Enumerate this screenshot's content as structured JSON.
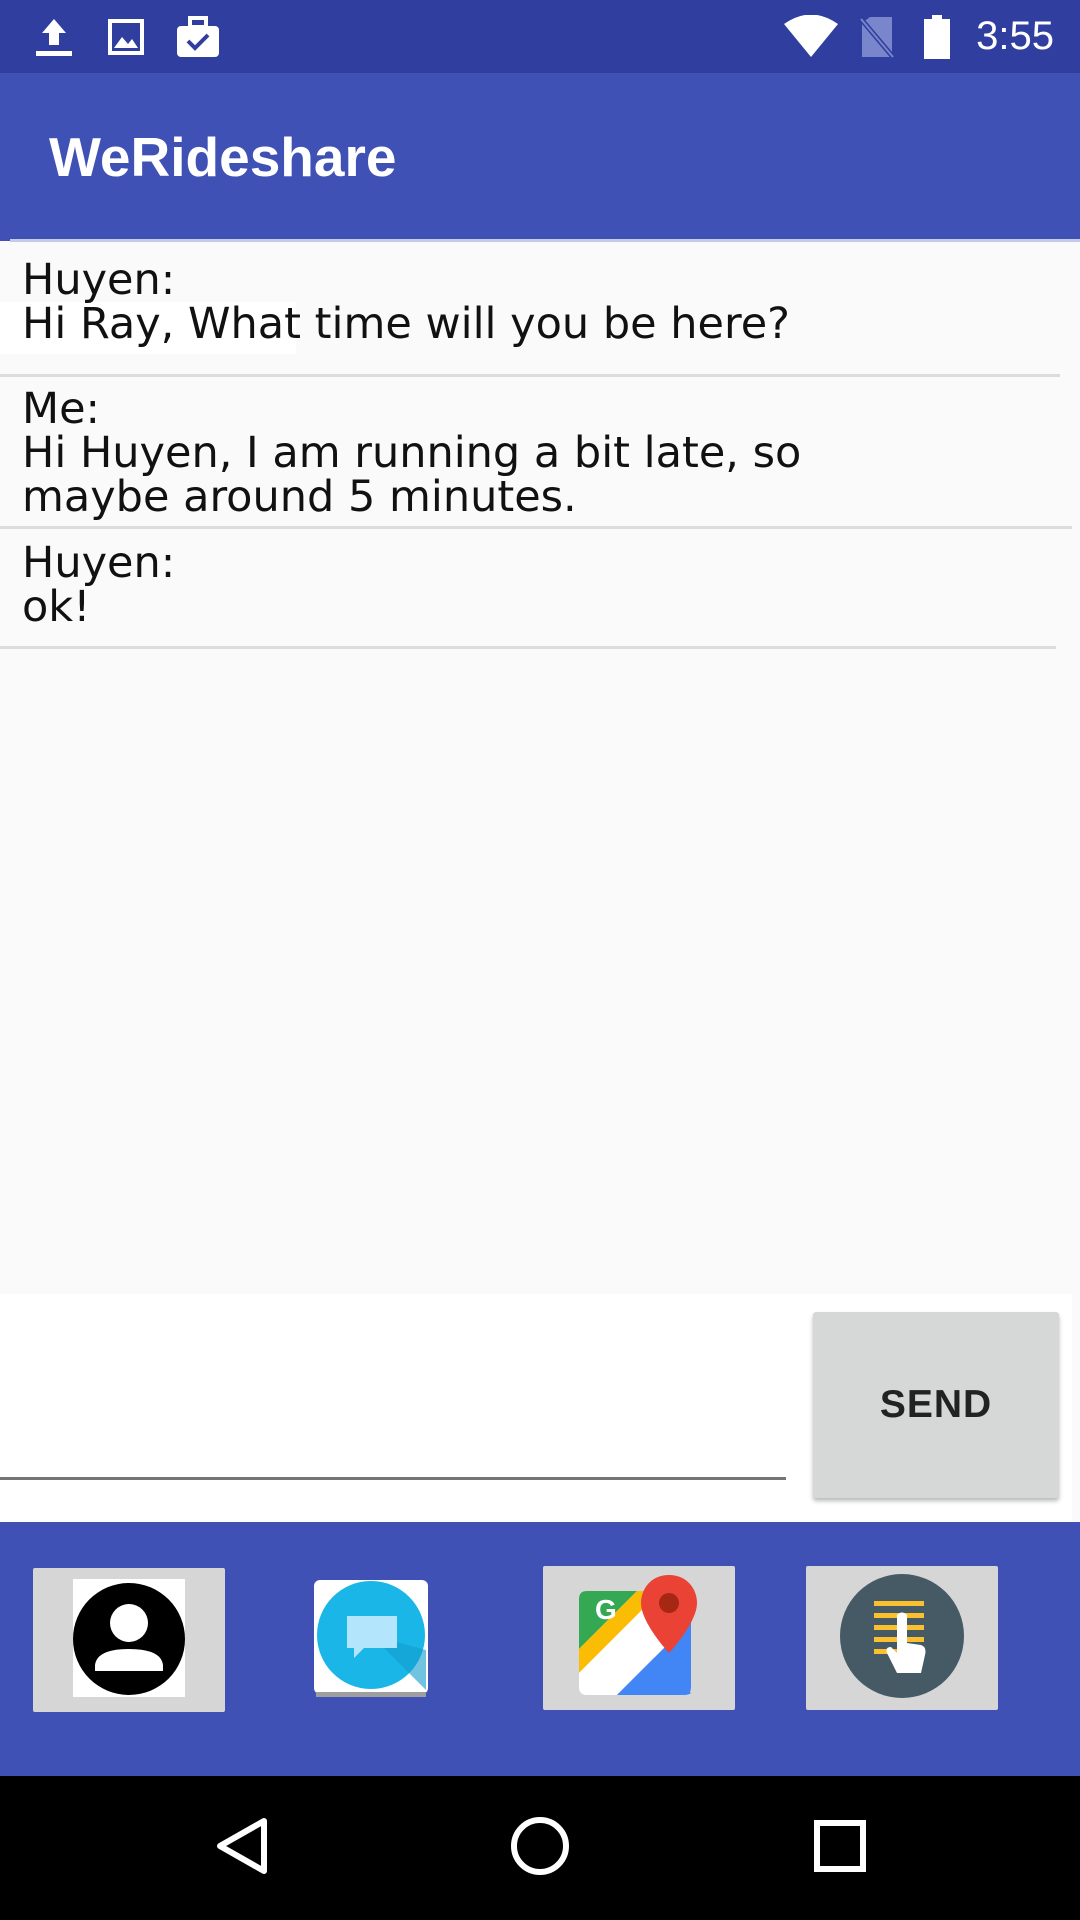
{
  "status_bar": {
    "time": "3:55",
    "left_icons": [
      "upload-icon",
      "image-icon",
      "briefcase-check-icon"
    ],
    "right_icons": [
      "wifi-icon",
      "no-sim-icon",
      "battery-icon"
    ]
  },
  "app_bar": {
    "title": "WeRideshare"
  },
  "messages": [
    {
      "sender": "Huyen:",
      "text": "Hi Ray, What time will you be here?"
    },
    {
      "sender": "Me:",
      "text": "Hi Huyen, I am running a bit late, so\nmaybe around 5 minutes."
    },
    {
      "sender": "Huyen:",
      "text": "ok!"
    }
  ],
  "compose": {
    "input_value": "",
    "input_placeholder": "",
    "send_label": "SEND"
  },
  "bottom_nav": {
    "items": [
      "contacts-icon",
      "messages-icon",
      "maps-icon",
      "touch-menu-icon"
    ]
  },
  "system_nav": {
    "buttons": [
      "back-icon",
      "home-icon",
      "recents-icon"
    ]
  },
  "colors": {
    "status_bar": "#303f9f",
    "primary": "#3f51b5",
    "send_button": "#d6d7d7"
  }
}
